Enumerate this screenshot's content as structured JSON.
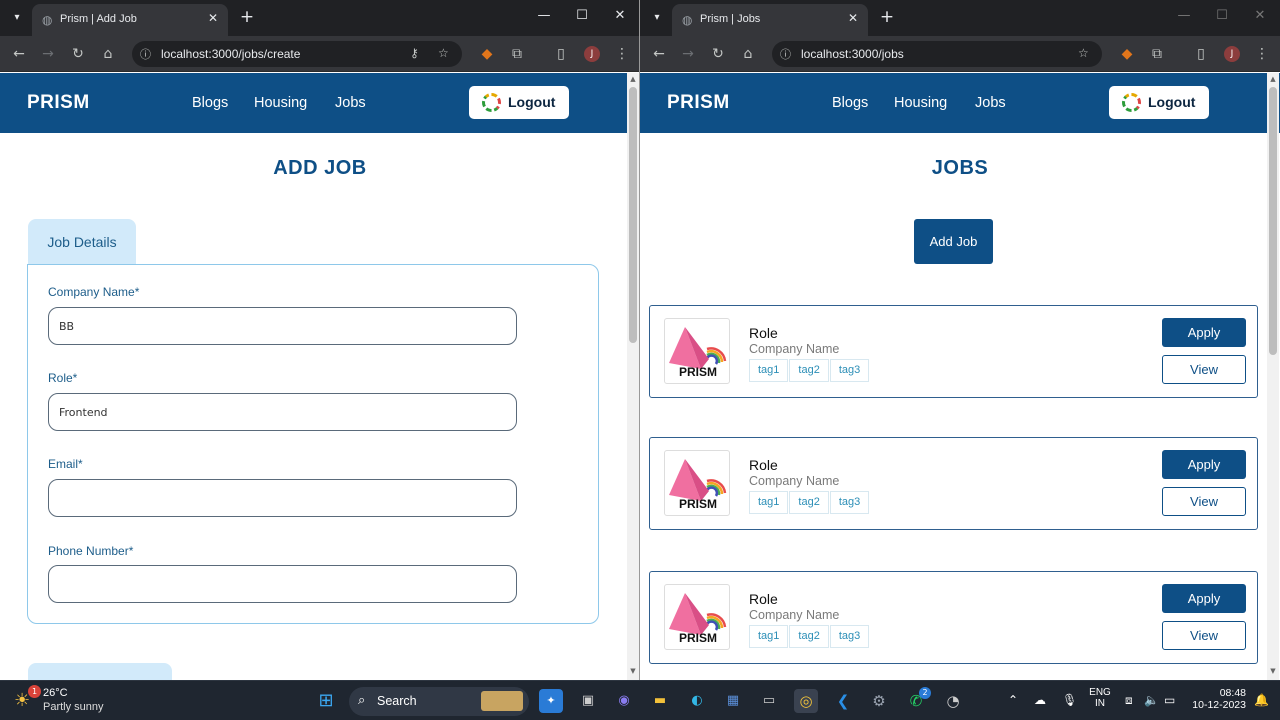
{
  "left": {
    "tab_title": "Prism | Add Job",
    "url": "localhost:3000/jobs/create",
    "brand": "PRISM",
    "nav": [
      "Blogs",
      "Housing",
      "Jobs"
    ],
    "logout": "Logout",
    "heading": "ADD JOB",
    "section_tab": "Job Details",
    "fields": [
      {
        "label": "Company Name*",
        "value": "BB"
      },
      {
        "label": "Role*",
        "value": "Frontend"
      },
      {
        "label": "Email*",
        "value": ""
      },
      {
        "label": "Phone Number*",
        "value": ""
      }
    ]
  },
  "right": {
    "tab_title": "Prism | Jobs",
    "url": "localhost:3000/jobs",
    "brand": "PRISM",
    "nav": [
      "Blogs",
      "Housing",
      "Jobs"
    ],
    "logout": "Logout",
    "heading": "JOBS",
    "add_job": "Add Job",
    "cards": [
      {
        "logo": "PRISM",
        "role": "Role",
        "company": "Company Name",
        "tags": [
          "tag1",
          "tag2",
          "tag3"
        ],
        "apply": "Apply",
        "view": "View"
      },
      {
        "logo": "PRISM",
        "role": "Role",
        "company": "Company Name",
        "tags": [
          "tag1",
          "tag2",
          "tag3"
        ],
        "apply": "Apply",
        "view": "View"
      },
      {
        "logo": "PRISM",
        "role": "Role",
        "company": "Company Name",
        "tags": [
          "tag1",
          "tag2",
          "tag3"
        ],
        "apply": "Apply",
        "view": "View"
      }
    ]
  },
  "taskbar": {
    "weather_temp": "26°C",
    "weather_desc": "Partly sunny",
    "weather_badge": "1",
    "search": "Search",
    "whatsapp_badge": "2",
    "lang": "ENG",
    "region": "IN",
    "time": "08:48",
    "date": "10-12-2023"
  },
  "colors": {
    "brand": "#0e4f86",
    "section_bg": "#d2eafa",
    "tag_text": "#2d8fb7"
  }
}
